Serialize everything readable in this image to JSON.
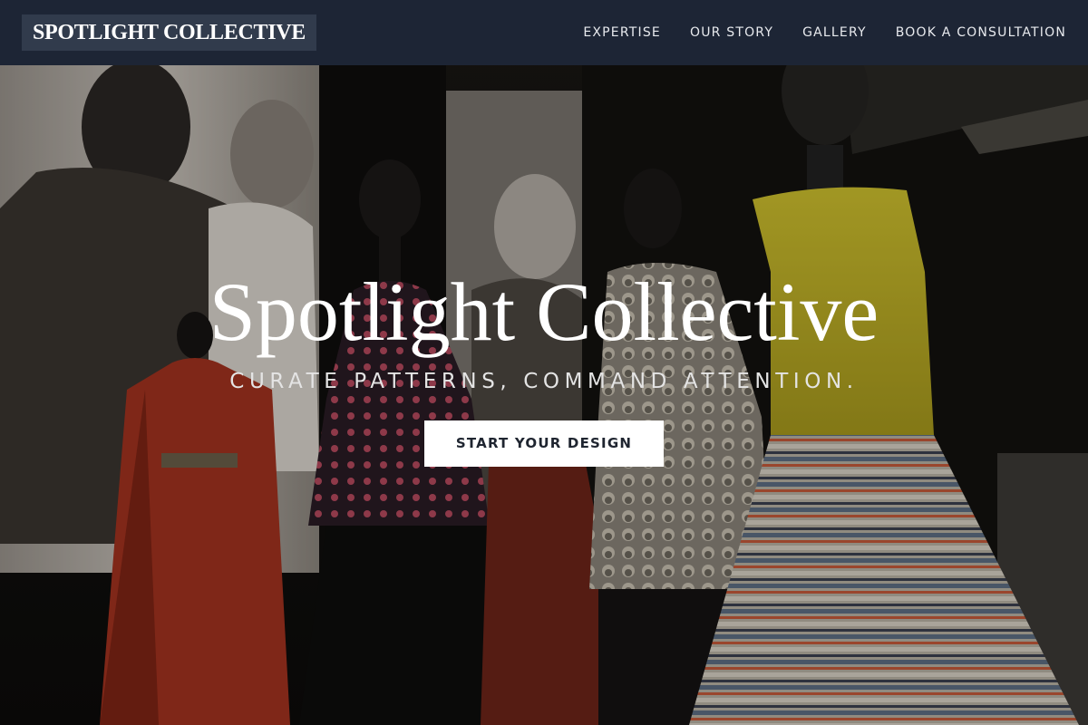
{
  "brand": {
    "name": "SPOTLIGHT COLLECTIVE"
  },
  "nav": {
    "links": [
      {
        "label": "EXPERTISE"
      },
      {
        "label": "OUR STORY"
      },
      {
        "label": "GALLERY"
      },
      {
        "label": "BOOK A CONSULTATION"
      }
    ]
  },
  "hero": {
    "title": "Spotlight Collective",
    "tagline": "CURATE PATTERNS, COMMAND ATTENTION.",
    "cta_label": "START YOUR DESIGN",
    "background_image": "fashion-exhibition-mannequins"
  },
  "colors": {
    "navbar": "#1d2535",
    "brand_box": "#313b4c",
    "cta_background": "#ffffff",
    "cta_text": "#1f2530"
  }
}
